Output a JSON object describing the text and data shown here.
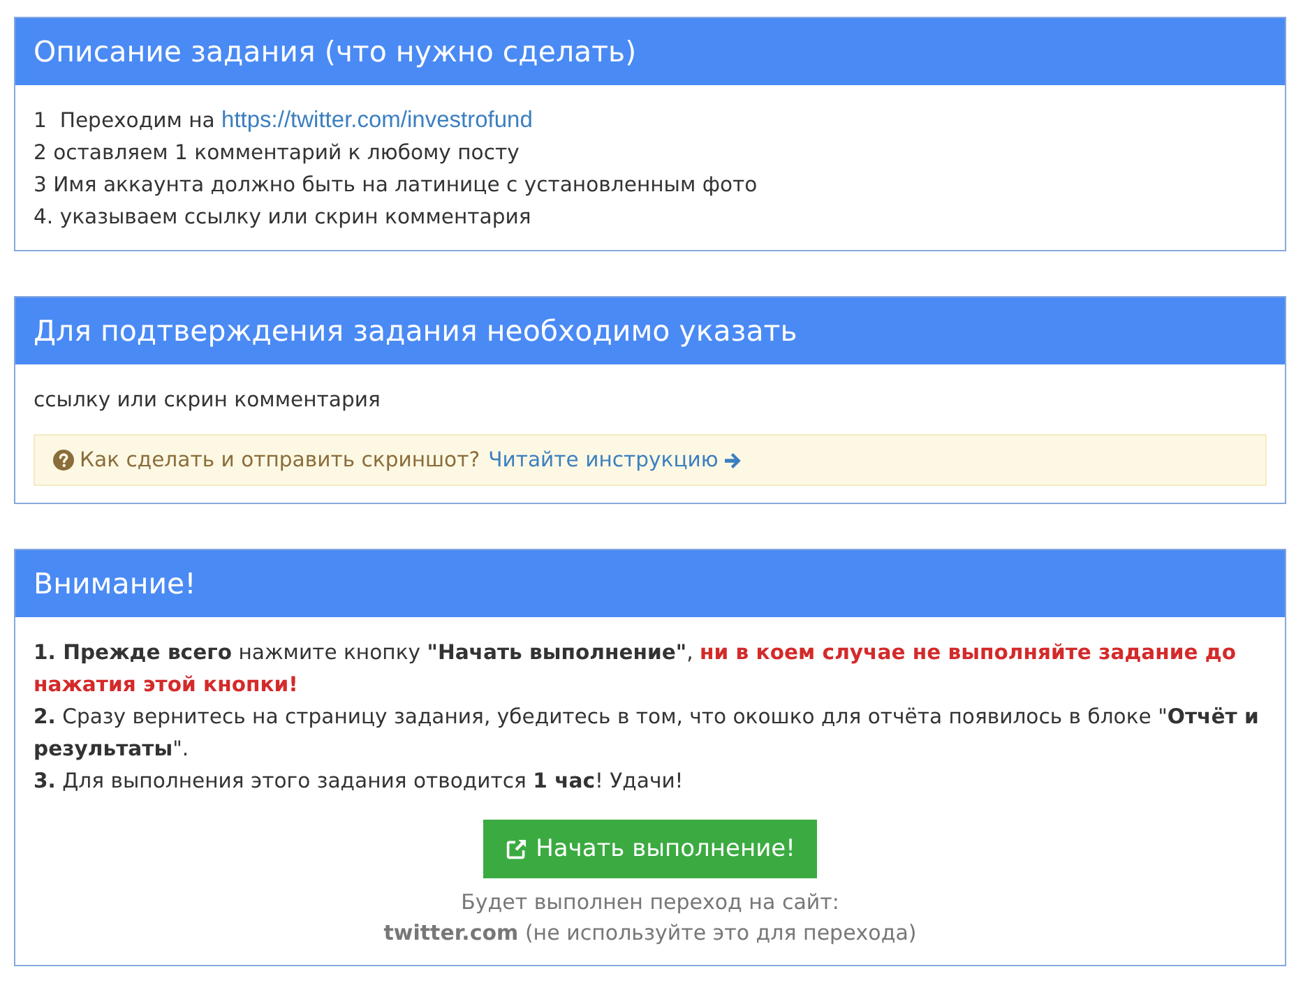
{
  "task_description": {
    "title": "Описание задания (что нужно сделать)",
    "steps": [
      {
        "text": "1  Переходим на",
        "link": "https://twitter.com/investrofund"
      },
      {
        "text": "2 оставляем 1 комментарий к любому посту"
      },
      {
        "text": "3 Имя аккаунта должно быть на латинице с установленным фото"
      },
      {
        "text": "4. указываем ссылку или скрин комментария"
      }
    ]
  },
  "confirmation": {
    "title": "Для подтверждения задания необходимо указать",
    "requirement": "ссылку или скрин комментария",
    "hint": {
      "text": "Как сделать и отправить скриншот?",
      "link": "Читайте инструкцию"
    }
  },
  "warning": {
    "title": "Внимание!",
    "items": [
      {
        "text": "**1. Прежде всего** нажмите кнопку **\"Начать выполнение\"**,",
        "alert": "ни в коем случае не выполняйте задание до нажатия этой кнопки!"
      },
      {
        "text": "**2.** Сразу вернитесь на страницу задания, убедитесь в том, что окошко для отчёта появилось в блоке \"**Отчёт и результаты**\"."
      },
      {
        "text": "**3.** Для выполнения этого задания отводится **1 час**! Удачи!"
      }
    ],
    "button": "Начать выполнение!",
    "redirect_note": "Будет выполнен переход на сайт:",
    "redirect_target": "**twitter.com** (не используйте это для перехода)"
  }
}
